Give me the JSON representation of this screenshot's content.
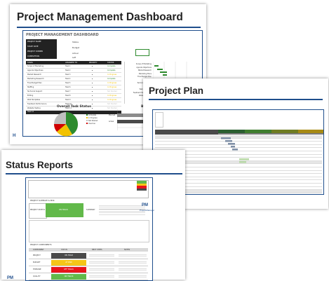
{
  "dashboard": {
    "heading": "Project Management Dashboard",
    "inner_title": "PROJECT MANAGEMENT DASHBOARD",
    "info_labels": [
      "PROJECT NAME",
      "START DATE",
      "PROJECT OWNER",
      "COMPLETION"
    ],
    "info_fields": [
      "Status",
      "Budget",
      "Actual",
      "Left"
    ],
    "task_header": [
      "TASKS",
      "ASSIGNED TO",
      "PRIORITY",
      "STATUS"
    ],
    "task_rows": [
      [
        "Scope of Marketing",
        "Task 1",
        "Complete"
      ],
      [
        "Agenda Objectives",
        "Task 2",
        "Complete"
      ],
      [
        "Market Research",
        "Task 3",
        "In Progress"
      ],
      [
        "Marketing Research",
        "Task 4",
        "Complete"
      ],
      [
        "Final Budget Plan",
        "Task 5",
        "In Progress"
      ],
      [
        "Staffing",
        "Task 6",
        "In Progress"
      ],
      [
        "Technical Support",
        "Task 7",
        "Not Started"
      ],
      [
        "Editing",
        "Task 8",
        "In Progress"
      ],
      [
        "Web Templates",
        "Task 9",
        "In Progress"
      ],
      [
        "Feedback Performance",
        "Task 10",
        "Not Started"
      ],
      [
        "Website Testing",
        "Task 11",
        "Not Started"
      ]
    ],
    "task_total": "Task 12",
    "pie_title": "Overall Task Status",
    "pie_legend": [
      "Complete",
      "In Progress",
      "Not Started",
      "Overdue"
    ],
    "budget_title": "Budget",
    "budget_rows": [
      "Planned",
      "Actual"
    ],
    "gantt_labels": [
      "Scope of Marketing",
      "Agenda Objectives",
      "Market Research",
      "Marketing Plans",
      "Final Budget Plan",
      "Staffing",
      "Technical Support",
      "Editing",
      "Web Templates",
      "Feedback Performance",
      "Website Testing",
      "Launch"
    ]
  },
  "project_plan": {
    "heading": "Project Plan",
    "logo": "PM",
    "logo_sub": "ProjectManager"
  },
  "status_reports": {
    "heading": "Status Reports",
    "summary_title": "PROJECT SUMMARY & RISK",
    "project_status_label": "PROJECT STATUS",
    "project_status_value": "ON TRACK",
    "summary_label": "SUMMARY",
    "milestones_title": "PROJECT COMPONENTS",
    "components_header": [
      "COMPONENT",
      "STATUS",
      "NEXT STEPS",
      "NOTES"
    ],
    "components": [
      {
        "name": "PROJECT",
        "status": "ON HOLD",
        "color": "#4a4a4a"
      },
      {
        "name": "BUDGET",
        "status": "AT RISK",
        "color": "#f5c518"
      },
      {
        "name": "TIMELINE",
        "status": "OFF TRACK",
        "color": "#e8141b"
      },
      {
        "name": "QUALITY",
        "status": "ON TRACK",
        "color": "#62b94a"
      }
    ],
    "logo": "PM",
    "logo_sub": "ProjectManager"
  },
  "colors": {
    "brand": "#1f4e8c",
    "complete": "#2e8b2e",
    "in_progress": "#f2c200",
    "not_started": "#bfbfbf",
    "overdue": "#d00000"
  }
}
